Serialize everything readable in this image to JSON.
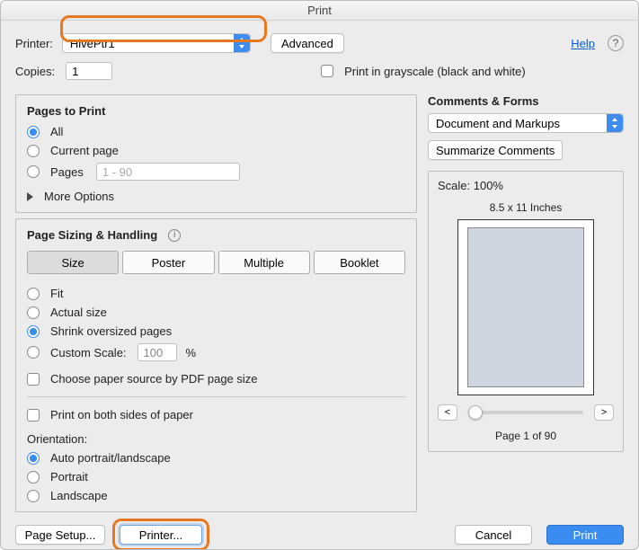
{
  "title": "Print",
  "header": {
    "printer_label": "Printer:",
    "printer_value": "HivePtr1",
    "advanced": "Advanced",
    "help": "Help",
    "help_icon": "?",
    "copies_label": "Copies:",
    "copies_value": "1",
    "grayscale_label": "Print in grayscale (black and white)"
  },
  "pages": {
    "heading": "Pages to Print",
    "all": "All",
    "current": "Current page",
    "pages": "Pages",
    "range_placeholder": "1 - 90",
    "more_options": "More Options"
  },
  "sizing": {
    "heading": "Page Sizing & Handling",
    "tabs": {
      "size": "Size",
      "poster": "Poster",
      "multiple": "Multiple",
      "booklet": "Booklet"
    },
    "fit": "Fit",
    "actual": "Actual size",
    "shrink": "Shrink oversized pages",
    "custom_label": "Custom Scale:",
    "custom_value": "100",
    "percent": "%",
    "choose_source": "Choose paper source by PDF page size"
  },
  "duplex": "Print on both sides of paper",
  "orientation": {
    "heading": "Orientation:",
    "auto": "Auto portrait/landscape",
    "portrait": "Portrait",
    "landscape": "Landscape"
  },
  "comments": {
    "heading": "Comments & Forms",
    "select_value": "Document and Markups",
    "summarize": "Summarize Comments"
  },
  "preview": {
    "scale": "Scale: 100%",
    "dims": "8.5 x 11 Inches",
    "page_nav": "Page 1 of 90",
    "left": "<",
    "right": ">"
  },
  "footer": {
    "page_setup": "Page Setup...",
    "printer": "Printer...",
    "cancel": "Cancel",
    "print": "Print"
  }
}
